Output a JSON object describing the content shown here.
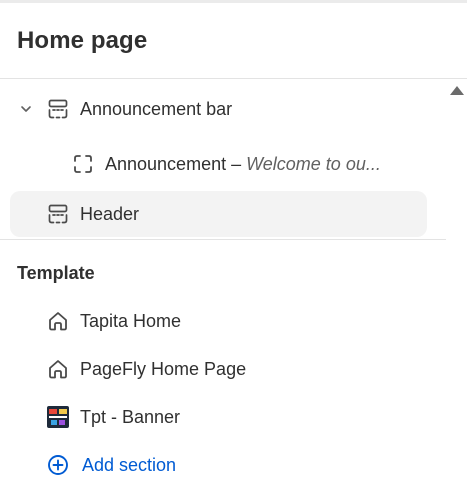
{
  "page": {
    "title": "Home page"
  },
  "header_group": {
    "items": [
      {
        "label": "Announcement bar",
        "icon": "section-layout-icon",
        "expanded": true
      },
      {
        "label": "Announcement",
        "separator": " – ",
        "detail": "Welcome to ou...",
        "icon": "block-icon"
      },
      {
        "label": "Header",
        "icon": "section-layout-icon",
        "selected": true
      }
    ]
  },
  "template": {
    "heading": "Template",
    "items": [
      {
        "label": "Tapita Home",
        "icon": "home-icon"
      },
      {
        "label": "PageFly Home Page",
        "icon": "home-icon"
      },
      {
        "label": "Tpt - Banner",
        "icon": "banner-thumbnail-icon"
      }
    ],
    "add_section": {
      "label": "Add section",
      "icon": "plus-circle-icon",
      "color": "#005bd3"
    }
  },
  "colors": {
    "text": "#303030",
    "muted": "#616161",
    "selected_bg": "#f3f3f3",
    "link": "#005bd3",
    "divider": "#e3e3e3"
  }
}
